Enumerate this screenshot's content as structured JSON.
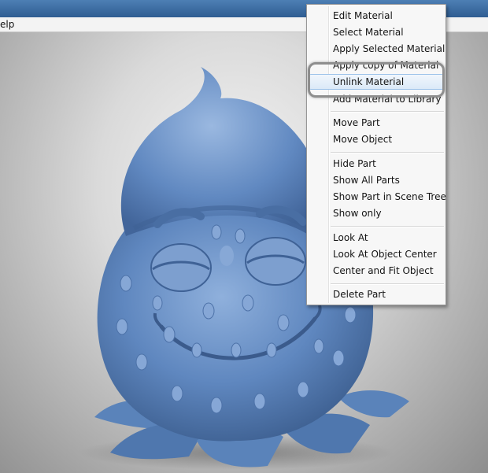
{
  "menubar": {
    "partial_label": "elp"
  },
  "context_menu": {
    "groups": [
      [
        "Edit Material",
        "Select Material",
        "Apply Selected Material",
        "Apply copy of Material",
        "Unlink Material",
        "Add Material to Library"
      ],
      [
        "Move Part",
        "Move Object"
      ],
      [
        "Hide Part",
        "Show All Parts",
        "Show Part in Scene Tree",
        "Show only"
      ],
      [
        "Look At",
        "Look At Object Center",
        "Center and Fit Object"
      ],
      [
        "Delete Part"
      ]
    ],
    "hovered_item": "Unlink Material"
  },
  "colors": {
    "model": "#5d86bd",
    "title_bar": "#3a6aa0",
    "menu_hover_border": "#9ec3ea",
    "callout_ring": "#8e8e8e"
  }
}
